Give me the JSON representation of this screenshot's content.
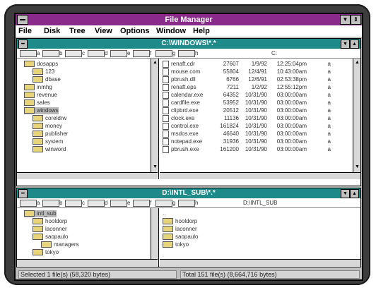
{
  "window": {
    "title": "File Manager"
  },
  "menu": [
    "File",
    "Disk",
    "Tree",
    "View",
    "Options",
    "Window",
    "Help"
  ],
  "pane1": {
    "title": "C:\\WINDOWS\\*.*",
    "drive_label": "C:",
    "drives": [
      "a",
      "b",
      "c",
      "d",
      "e",
      "f",
      "g",
      "h"
    ],
    "tree": [
      {
        "name": "dosapps",
        "depth": 1,
        "open": true
      },
      {
        "name": "123",
        "depth": 2
      },
      {
        "name": "dbase",
        "depth": 2
      },
      {
        "name": "inmhg",
        "depth": 1
      },
      {
        "name": "revenue",
        "depth": 1
      },
      {
        "name": "sales",
        "depth": 1
      },
      {
        "name": "windows",
        "depth": 1,
        "open": true,
        "selected": true
      },
      {
        "name": "coreldrw",
        "depth": 2
      },
      {
        "name": "money",
        "depth": 2
      },
      {
        "name": "publisher",
        "depth": 2
      },
      {
        "name": "system",
        "depth": 2
      },
      {
        "name": "winword",
        "depth": 2
      }
    ],
    "files": [
      {
        "name": "renaft.cdr",
        "size": "27607",
        "date": "1/9/92",
        "time": "12:25:04pm",
        "attr": "a"
      },
      {
        "name": "mouse.com",
        "size": "55804",
        "date": "12/4/91",
        "time": "10:43:00am",
        "attr": "a"
      },
      {
        "name": "pbrush.dll",
        "size": "6766",
        "date": "12/6/91",
        "time": "02:53:38pm",
        "attr": "a"
      },
      {
        "name": "renaft.eps",
        "size": "7211",
        "date": "1/2/92",
        "time": "12:55:12pm",
        "attr": "a"
      },
      {
        "name": "calendar.exe",
        "size": "64352",
        "date": "10/31/90",
        "time": "03:00:00am",
        "attr": "a"
      },
      {
        "name": "cardfile.exe",
        "size": "53952",
        "date": "10/31/90",
        "time": "03:00:00am",
        "attr": "a"
      },
      {
        "name": "clipbrd.exe",
        "size": "20512",
        "date": "10/31/90",
        "time": "03:00:00am",
        "attr": "a"
      },
      {
        "name": "clock.exe",
        "size": "11136",
        "date": "10/31/90",
        "time": "03:00:00am",
        "attr": "a"
      },
      {
        "name": "control.exe",
        "size": "161824",
        "date": "10/31/90",
        "time": "03:00:00am",
        "attr": "a"
      },
      {
        "name": "msdos.exe",
        "size": "46640",
        "date": "10/31/90",
        "time": "03:00:00am",
        "attr": "a"
      },
      {
        "name": "notepad.exe",
        "size": "31936",
        "date": "10/31/90",
        "time": "03:00:00am",
        "attr": "a"
      },
      {
        "name": "pbrush.exe",
        "size": "161200",
        "date": "10/31/90",
        "time": "03:00:00am",
        "attr": "a"
      }
    ]
  },
  "pane2": {
    "title": "D:\\INTL_SUB\\*.*",
    "drive_label": "D:\\INTL_SUB",
    "drives": [
      "a",
      "b",
      "c",
      "d",
      "e",
      "f",
      "g",
      "h"
    ],
    "tree": [
      {
        "name": "intl_sub",
        "depth": 1,
        "open": true,
        "selected": true
      },
      {
        "name": "hooldorp",
        "depth": 2
      },
      {
        "name": "laconner",
        "depth": 2
      },
      {
        "name": "saopaulo",
        "depth": 2
      },
      {
        "name": "managers",
        "depth": 3
      },
      {
        "name": "tokyo",
        "depth": 2
      }
    ],
    "files": [
      "..",
      "hooldorp",
      "laconner",
      "saopaulo",
      "tokyo"
    ]
  },
  "status": {
    "selected": "Selected 1 file(s) (58,320 bytes)",
    "total": "Total 151 file(s) (8,664,716 bytes)"
  }
}
